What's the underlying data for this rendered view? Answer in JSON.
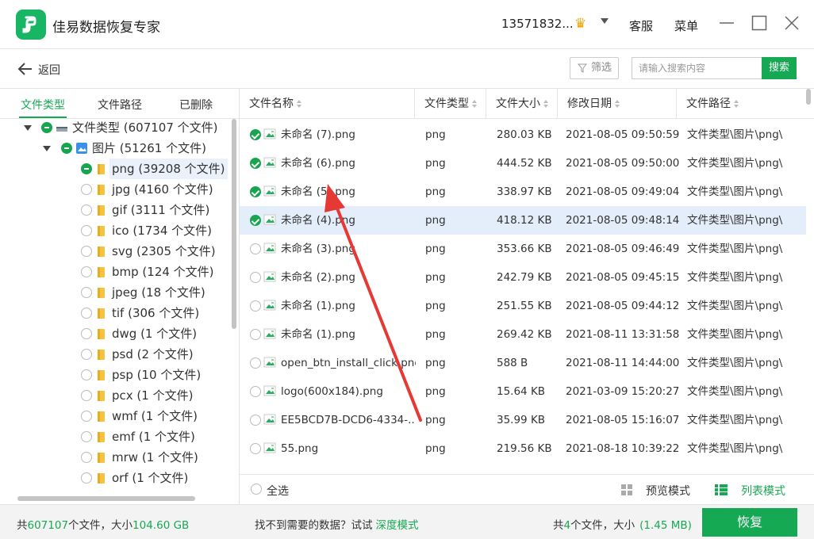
{
  "app": {
    "title": "佳易数据恢复专家"
  },
  "titlebar": {
    "account": "13571832...",
    "crown_icon": "crown-icon",
    "service": "客服",
    "menu": "菜单"
  },
  "toolbar": {
    "back": "返回",
    "filter": "筛选",
    "search_placeholder": "请输入搜索内容",
    "search": "搜索"
  },
  "left_tabs": [
    "文件类型",
    "文件路径",
    "已删除"
  ],
  "tree": {
    "root": "文件类型 (607107 个文件)",
    "images": "图片 (51261 个文件)",
    "items": [
      "png (39208 个文件)",
      "jpg (4160 个文件)",
      "gif (3111 个文件)",
      "ico (1734 个文件)",
      "svg (2305 个文件)",
      "bmp (124 个文件)",
      "jpeg (18 个文件)",
      "tif (306 个文件)",
      "dwg (1 个文件)",
      "psd (2 个文件)",
      "psp (10 个文件)",
      "pcx (1 个文件)",
      "wmf (1 个文件)",
      "emf (1 个文件)",
      "mrw (1 个文件)",
      "orf (1 个文件)"
    ]
  },
  "table": {
    "columns": [
      "文件名称",
      "文件类型",
      "文件大小",
      "修改日期",
      "文件路径"
    ],
    "rows": [
      {
        "name": "未命名 (7).png",
        "type": "png",
        "size": "280.03 KB",
        "date": "2021-08-05 09:50:59",
        "path": "文件类型\\图片\\png\\",
        "checked": true
      },
      {
        "name": "未命名 (6).png",
        "type": "png",
        "size": "444.52 KB",
        "date": "2021-08-05 09:50:00",
        "path": "文件类型\\图片\\png\\",
        "checked": true
      },
      {
        "name": "未命名 (5).png",
        "type": "png",
        "size": "338.97 KB",
        "date": "2021-08-05 09:49:04",
        "path": "文件类型\\图片\\png\\",
        "checked": true
      },
      {
        "name": "未命名 (4).png",
        "type": "png",
        "size": "418.12 KB",
        "date": "2021-08-05 09:48:14",
        "path": "文件类型\\图片\\png\\",
        "checked": true
      },
      {
        "name": "未命名 (3).png",
        "type": "png",
        "size": "353.66 KB",
        "date": "2021-08-05 09:46:49",
        "path": "文件类型\\图片\\png\\",
        "checked": false
      },
      {
        "name": "未命名 (2).png",
        "type": "png",
        "size": "242.79 KB",
        "date": "2021-08-05 09:45:15",
        "path": "文件类型\\图片\\png\\",
        "checked": false
      },
      {
        "name": "未命名 (1).png",
        "type": "png",
        "size": "251.55 KB",
        "date": "2021-08-05 09:44:12",
        "path": "文件类型\\图片\\png\\",
        "checked": false
      },
      {
        "name": "未命名 (1).png",
        "type": "png",
        "size": "269.42 KB",
        "date": "2021-08-11 13:31:58",
        "path": "文件类型\\图片\\png\\",
        "checked": false
      },
      {
        "name": "open_btn_install_click.png",
        "type": "png",
        "size": "588 B",
        "date": "2021-08-11 14:44:00",
        "path": "文件类型\\图片\\png\\",
        "checked": false
      },
      {
        "name": "logo(600x184).png",
        "type": "png",
        "size": "15.64 KB",
        "date": "2021-03-09 15:20:27",
        "path": "文件类型\\图片\\png\\",
        "checked": false
      },
      {
        "name": "EE5BCD7B-DCD6-4334-...",
        "type": "png",
        "size": "35.99 KB",
        "date": "2021-08-05 15:16:07",
        "path": "文件类型\\图片\\png\\",
        "checked": false
      },
      {
        "name": "55.png",
        "type": "png",
        "size": "219.56 KB",
        "date": "2021-08-18 10:39:22",
        "path": "文件类型\\图片\\png\\",
        "checked": false
      }
    ]
  },
  "table_footer": {
    "select_all": "全选",
    "preview_mode": "预览模式",
    "list_mode": "列表模式"
  },
  "status": {
    "total_prefix": "共",
    "total_count": "607107",
    "total_mid": "个文件，大小",
    "total_size": "104.60 GB",
    "hint": "找不到需要的数据？试试",
    "deep_mode": "深度模式",
    "sel_prefix": "共",
    "sel_count": "4",
    "sel_mid": "个文件，大小",
    "sel_size": "(1.45 MB)",
    "restore": "恢复"
  },
  "colors": {
    "accent": "#16a953",
    "selected_row": "#e3eefa",
    "annotation_arrow": "#e53935"
  }
}
